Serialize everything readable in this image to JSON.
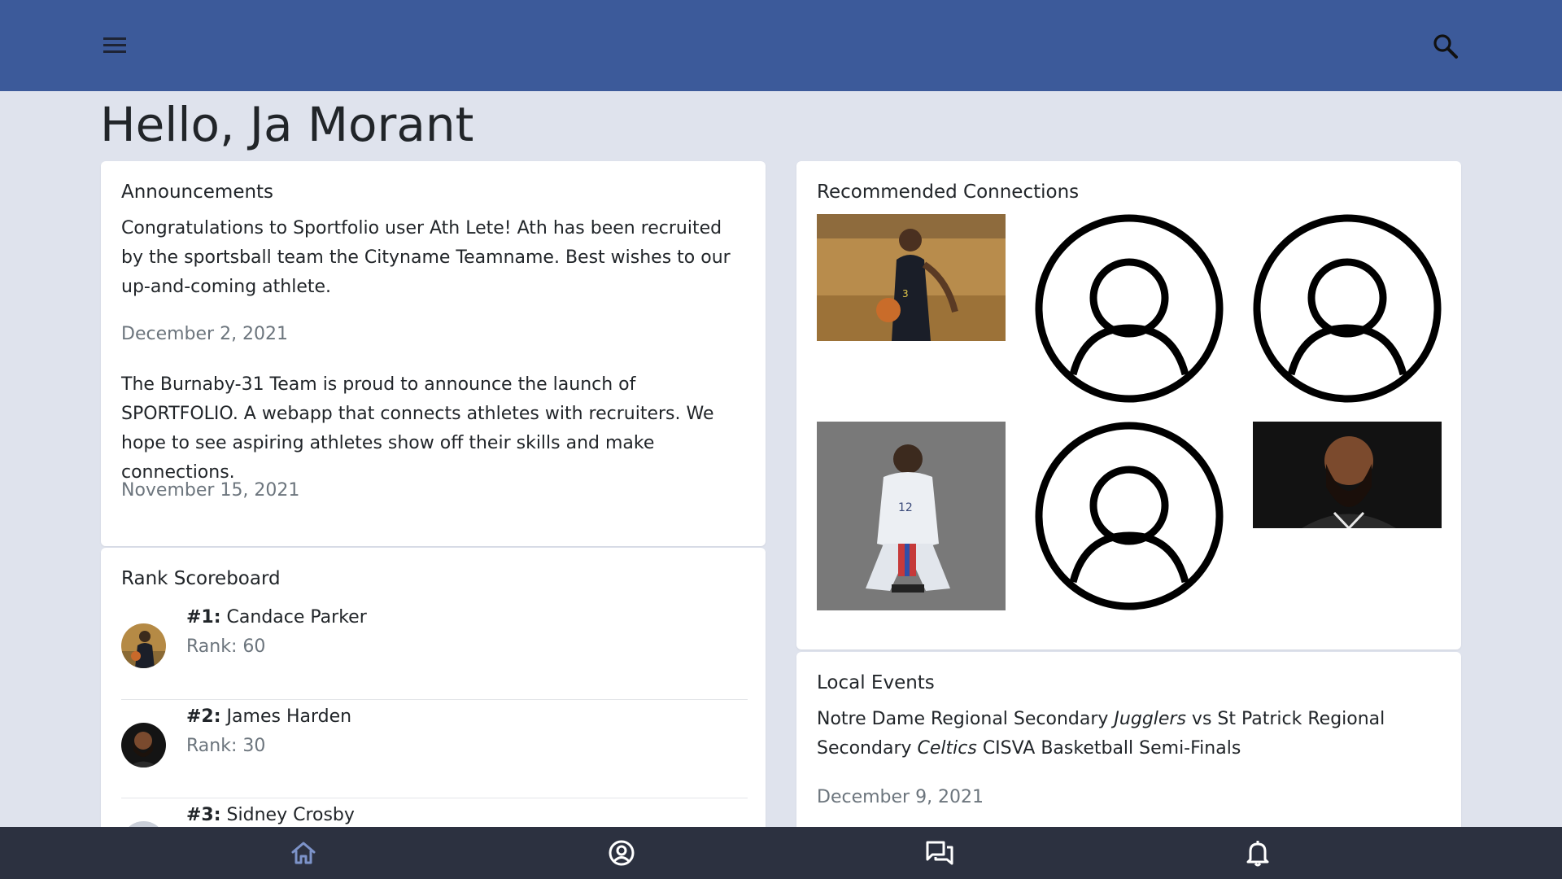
{
  "header": {
    "menu_icon": "hamburger-menu-icon",
    "search_icon": "search-icon"
  },
  "greeting": "Hello, Ja Morant",
  "announcements": {
    "title": "Announcements",
    "items": [
      {
        "text": "Congratulations to Sportfolio user Ath Lete! Ath has been recruited by the sportsball team the Cityname Teamname. Best wishes to our up-and-coming athlete.",
        "date": "December 2, 2021"
      },
      {
        "text": "The Burnaby-31 Team is proud to announce the launch of SPORTFOLIO. A webapp that connects athletes with recruiters. We hope to see aspiring athletes show off their skills and make connections.",
        "date": "November 15, 2021"
      }
    ]
  },
  "scoreboard": {
    "title": "Rank Scoreboard",
    "entries": [
      {
        "position": "#1:",
        "name": "Candace Parker",
        "rank": "Rank: 60"
      },
      {
        "position": "#2:",
        "name": "James Harden",
        "rank": "Rank: 30"
      },
      {
        "position": "#3:",
        "name": "Sidney Crosby",
        "rank": ""
      }
    ]
  },
  "connections": {
    "title": "Recommended Connections",
    "items": [
      {
        "type": "photo"
      },
      {
        "type": "placeholder"
      },
      {
        "type": "placeholder"
      },
      {
        "type": "photo"
      },
      {
        "type": "placeholder"
      },
      {
        "type": "photo"
      }
    ]
  },
  "events": {
    "title": "Local Events",
    "items": [
      {
        "part1": "Notre Dame Regional Secondary ",
        "em1": "Jugglers",
        "part2": " vs St Patrick Regional Secondary ",
        "em2": "Celtics",
        "part3": " CISVA Basketball Semi-Finals",
        "date": "December 9, 2021"
      }
    ]
  },
  "bottom_nav": [
    "home-icon",
    "profile-icon",
    "messages-icon",
    "notifications-icon"
  ],
  "colors": {
    "header": "#3c5a9a",
    "background": "#dfe3ed",
    "bottom_nav": "#2c3140",
    "active_nav": "#7d93c9"
  }
}
